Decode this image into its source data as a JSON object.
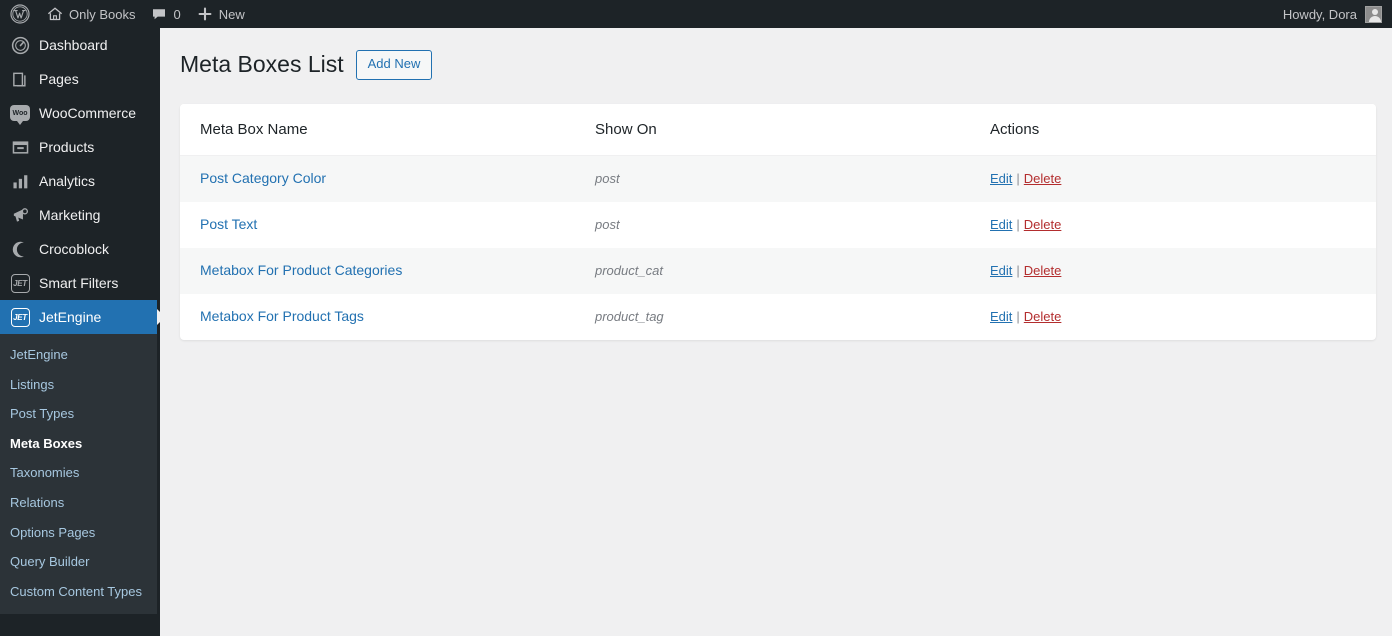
{
  "adminbar": {
    "wp_logo_icon": "wordpress-logo-icon",
    "site_icon": "home-icon",
    "site_name": "Only Books",
    "comments_icon": "comment-bubble-icon",
    "comments_count": "0",
    "new_icon": "plus-icon",
    "new_label": "New",
    "howdy": "Howdy, Dora",
    "avatar_icon": "user-avatar-icon"
  },
  "sidebar": {
    "items": [
      {
        "label": "Dashboard",
        "icon": "dashboard-gauge-icon",
        "current": false
      },
      {
        "label": "Pages",
        "icon": "pages-icon",
        "current": false
      },
      {
        "label": "WooCommerce",
        "icon": "woocommerce-icon",
        "current": false
      },
      {
        "label": "Products",
        "icon": "products-box-icon",
        "current": false
      },
      {
        "label": "Analytics",
        "icon": "analytics-bars-icon",
        "current": false
      },
      {
        "label": "Marketing",
        "icon": "marketing-megaphone-icon",
        "current": false
      },
      {
        "label": "Crocoblock",
        "icon": "crocoblock-moon-icon",
        "current": false
      },
      {
        "label": "Smart Filters",
        "icon": "jet-badge-icon",
        "current": false
      },
      {
        "label": "JetEngine",
        "icon": "jet-badge-icon",
        "current": true
      }
    ],
    "jet_badge_text": "JET",
    "woo_badge_text": "Woo",
    "submenu": [
      {
        "label": "JetEngine",
        "current": false
      },
      {
        "label": "Listings",
        "current": false
      },
      {
        "label": "Post Types",
        "current": false
      },
      {
        "label": "Meta Boxes",
        "current": true
      },
      {
        "label": "Taxonomies",
        "current": false
      },
      {
        "label": "Relations",
        "current": false
      },
      {
        "label": "Options Pages",
        "current": false
      },
      {
        "label": "Query Builder",
        "current": false
      },
      {
        "label": "Custom Content Types",
        "current": false
      }
    ]
  },
  "page": {
    "title": "Meta Boxes List",
    "add_new_label": "Add New"
  },
  "table": {
    "headers": {
      "name": "Meta Box Name",
      "show_on": "Show On",
      "actions": "Actions"
    },
    "action_labels": {
      "edit": "Edit",
      "separator": "|",
      "delete": "Delete"
    },
    "rows": [
      {
        "name": "Post Category Color",
        "show_on": "post"
      },
      {
        "name": "Post Text",
        "show_on": "post"
      },
      {
        "name": "Metabox For Product Categories",
        "show_on": "product_cat"
      },
      {
        "name": "Metabox For Product Tags",
        "show_on": "product_tag"
      }
    ]
  },
  "colors": {
    "admin_bar": "#1d2327",
    "sidebar": "#1d2327",
    "submenu": "#2c3338",
    "accent_blue": "#2271b1",
    "delete_red": "#b32d2e",
    "content_bg": "#f0f0f1",
    "row_alt": "#f6f7f7"
  }
}
